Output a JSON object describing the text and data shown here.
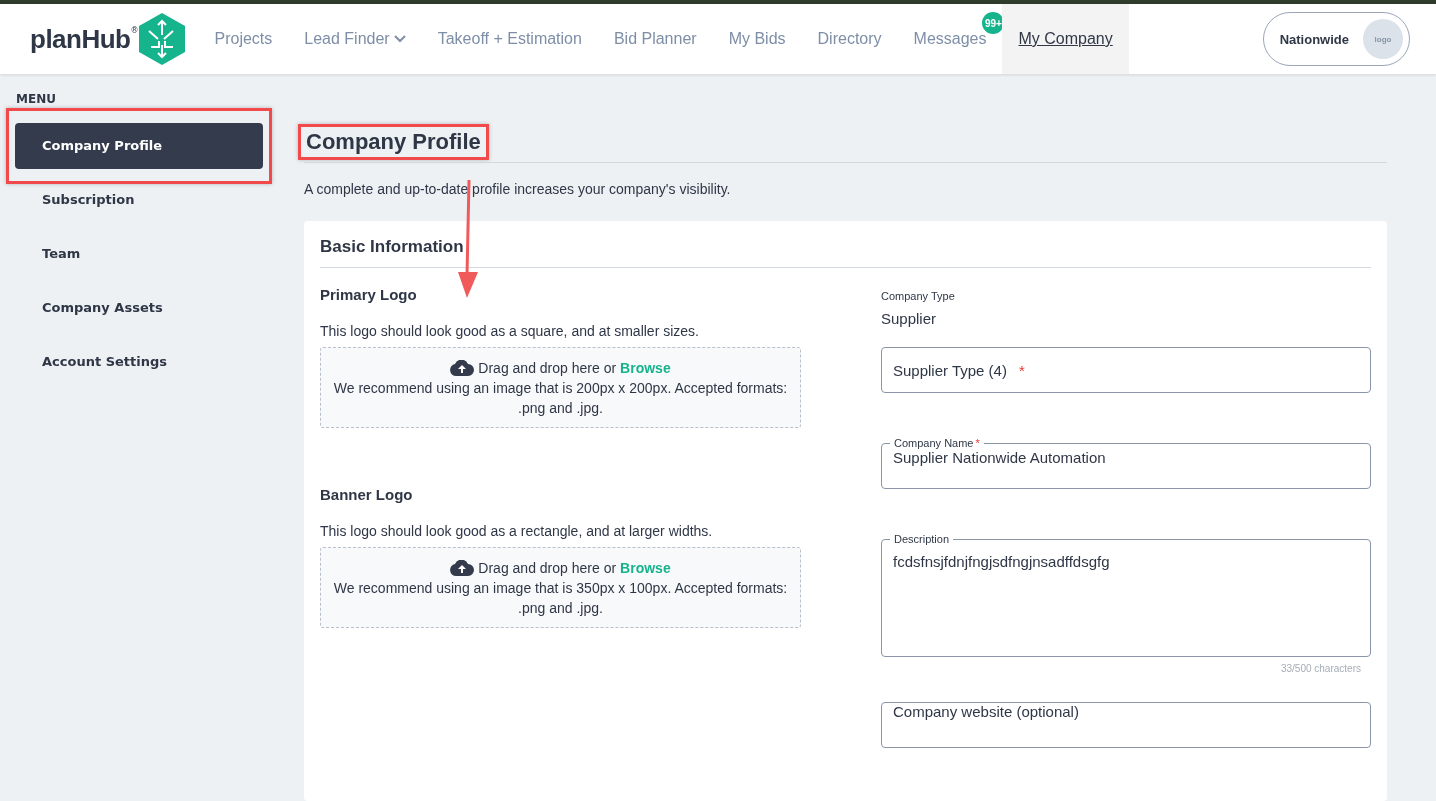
{
  "header": {
    "brand": "planHub",
    "brand_mark": "®",
    "nav": [
      {
        "label": "Projects",
        "selected": false
      },
      {
        "label": "Lead Finder",
        "selected": false,
        "has_menu": true
      },
      {
        "label": "Takeoff + Estimation",
        "selected": false
      },
      {
        "label": "Bid Planner",
        "selected": false
      },
      {
        "label": "My Bids",
        "selected": false
      },
      {
        "label": "Directory",
        "selected": false
      },
      {
        "label": "Messages",
        "selected": false,
        "badge": "99+"
      },
      {
        "label": "My Company",
        "selected": true
      }
    ],
    "account": {
      "name": "Nationwide",
      "avatar_text": "logo"
    }
  },
  "sidebar": {
    "title": "MENU",
    "items": [
      {
        "label": "Company Profile",
        "selected": true,
        "highlighted": true
      },
      {
        "label": "Subscription",
        "selected": false,
        "highlighted": false
      },
      {
        "label": "Team",
        "selected": false,
        "highlighted": false
      },
      {
        "label": "Company Assets",
        "selected": false,
        "highlighted": false
      },
      {
        "label": "Account Settings",
        "selected": false,
        "highlighted": false
      }
    ]
  },
  "page": {
    "title": "Company Profile",
    "title_highlighted": true,
    "subtitle": "A complete and up-to-date profile increases your company's visibility.",
    "section": {
      "title": "Basic Information",
      "uploads": [
        {
          "title": "Primary Logo",
          "description": "This logo should look good as a square, and at smaller sizes.",
          "drop_text": "Drag and drop here or",
          "browse": "Browse",
          "hint": "We recommend using an image that is 200px x 200px. Accepted formats: .png and .jpg."
        },
        {
          "title": "Banner Logo",
          "description": "This logo should look good as a rectangle, and at larger widths.",
          "drop_text": "Drag and drop here or",
          "browse": "Browse",
          "hint": "We recommend using an image that is 350px x 100px. Accepted formats: .png and .jpg."
        }
      ],
      "fields": [
        {
          "kind": "static",
          "label": "Company Type",
          "value": "Supplier"
        },
        {
          "kind": "select",
          "placeholder": "Supplier Type (4)",
          "required_mark": "*"
        },
        {
          "kind": "input",
          "label": "Company Name",
          "required_mark": "*",
          "value": "Supplier Nationwide Automation"
        },
        {
          "kind": "textarea",
          "label": "Description",
          "value": "fcdsfnsjfdnjfngjsdfngjnsadffdsgfg",
          "counter": "33/500 characters"
        },
        {
          "kind": "input",
          "placeholder": "Company website (optional)"
        }
      ]
    }
  }
}
